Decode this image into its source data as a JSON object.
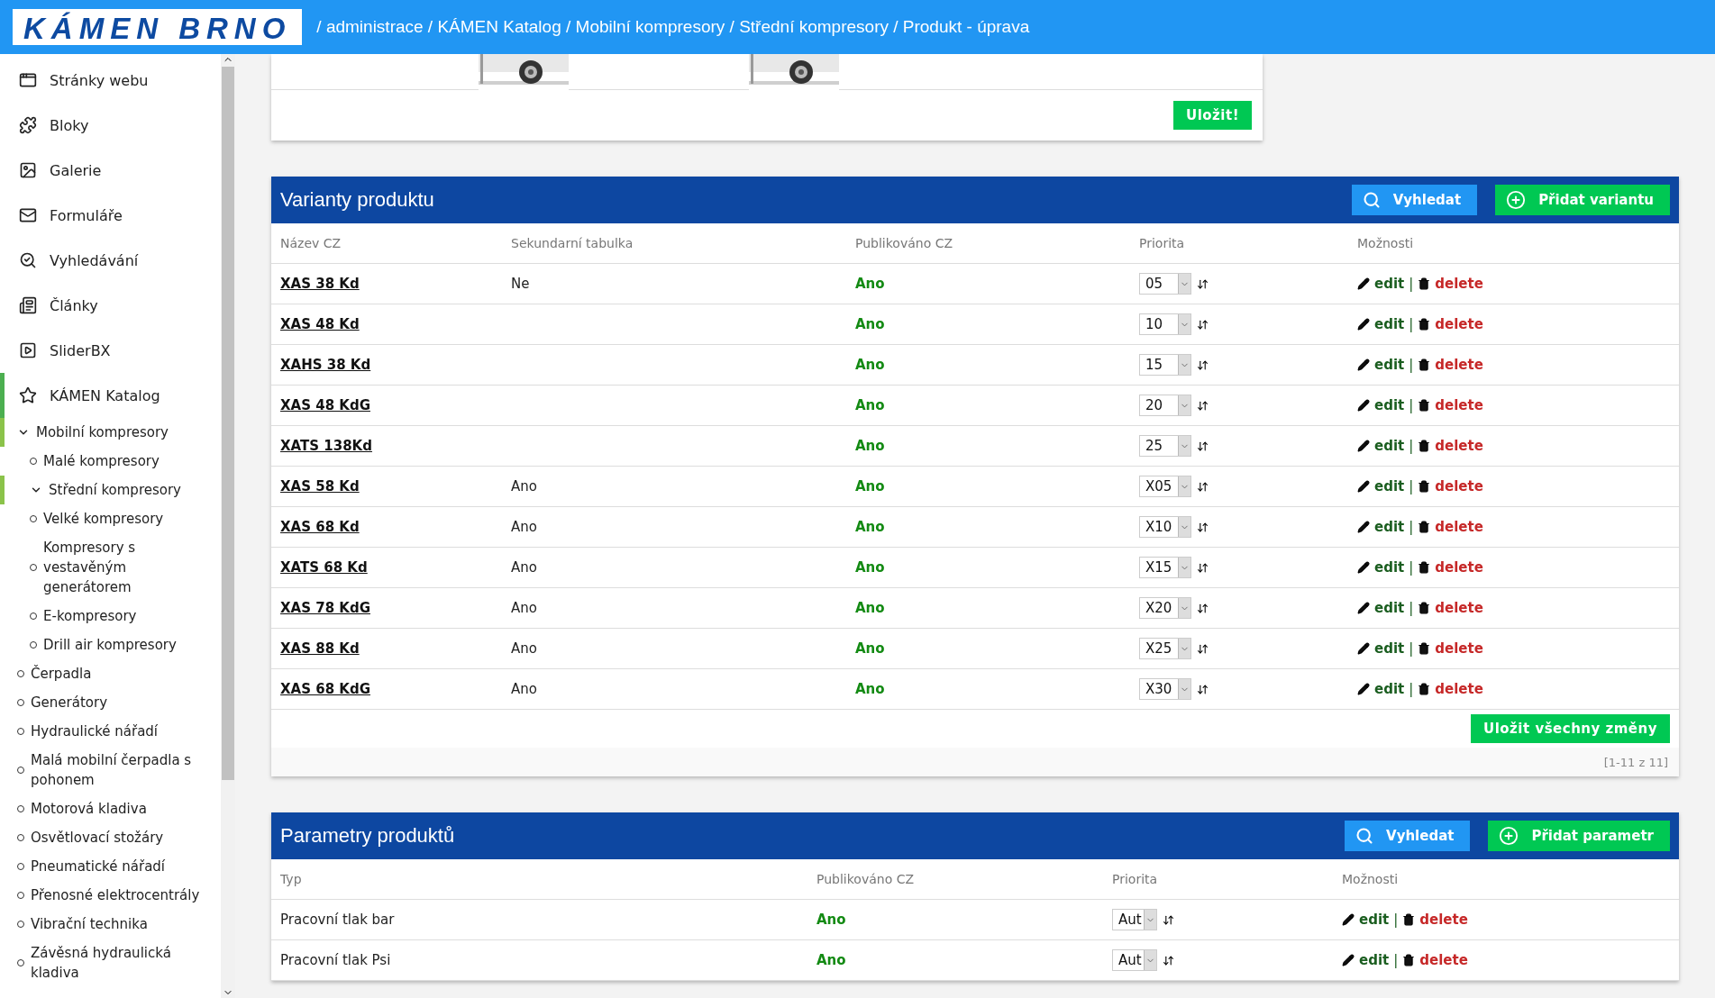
{
  "header": {
    "logo": "KÁMEN BRNO",
    "breadcrumb": "/ administrace / KÁMEN Katalog / Mobilní kompresory / Střední kompresory / Produkt - úprava"
  },
  "sidebar": {
    "items": [
      {
        "label": "Stránky webu",
        "selected": false
      },
      {
        "label": "Bloky",
        "selected": false
      },
      {
        "label": "Galerie",
        "selected": false
      },
      {
        "label": "Formuláře",
        "selected": false
      },
      {
        "label": "Vyhledávání",
        "selected": false
      },
      {
        "label": "Články",
        "selected": false
      },
      {
        "label": "SliderBX",
        "selected": false
      },
      {
        "label": "KÁMEN Katalog",
        "selected": true,
        "children": [
          {
            "label": "Mobilní kompresory",
            "selected": true,
            "expanded": true,
            "children": [
              {
                "label": "Malé kompresory",
                "selected": false,
                "expanded": false
              },
              {
                "label": "Střední kompresory",
                "selected": true,
                "expanded": true
              },
              {
                "label": "Velké kompresory",
                "selected": false,
                "expanded": false
              },
              {
                "label": "Kompresory s vestavěným generátorem",
                "selected": false,
                "expanded": false
              },
              {
                "label": "E-kompresory",
                "selected": false,
                "expanded": false
              },
              {
                "label": "Drill air kompresory",
                "selected": false,
                "expanded": false
              }
            ]
          },
          {
            "label": "Čerpadla",
            "selected": false,
            "expanded": false
          },
          {
            "label": "Generátory",
            "selected": false,
            "expanded": false
          },
          {
            "label": "Hydraulické nářadí",
            "selected": false,
            "expanded": false
          },
          {
            "label": "Malá mobilní čerpadla s pohonem",
            "selected": false,
            "expanded": false
          },
          {
            "label": "Motorová kladiva",
            "selected": false,
            "expanded": false
          },
          {
            "label": "Osvětlovací stožáry",
            "selected": false,
            "expanded": false
          },
          {
            "label": "Pneumatické nářadí",
            "selected": false,
            "expanded": false
          },
          {
            "label": "Přenosné elektrocentrály",
            "selected": false,
            "expanded": false
          },
          {
            "label": "Vibrační technika",
            "selected": false,
            "expanded": false
          },
          {
            "label": "Závěsná hydraulická kladiva",
            "selected": false,
            "expanded": false
          }
        ]
      }
    ]
  },
  "top_card": {
    "save_button": "Uložit!"
  },
  "variants": {
    "title": "Varianty produktu",
    "search_button": "Vyhledat",
    "add_button": "Přidat variantu",
    "columns": [
      "Název CZ",
      "Sekundarní tabulka",
      "Publikováno CZ",
      "Priorita",
      "Možnosti"
    ],
    "rows": [
      {
        "name": "XAS 38 Kd",
        "secondary": "Ne",
        "published": "Ano",
        "priority": "05",
        "edit": "edit",
        "separator": "|",
        "delete": "delete"
      },
      {
        "name": "XAS 48 Kd",
        "published": "Ano",
        "priority": "10",
        "edit": "edit",
        "separator": "|",
        "delete": "delete"
      },
      {
        "name": "XAHS 38 Kd",
        "published": "Ano",
        "priority": "15",
        "edit": "edit",
        "separator": "|",
        "delete": "delete"
      },
      {
        "name": "XAS 48 KdG",
        "published": "Ano",
        "priority": "20",
        "edit": "edit",
        "separator": "|",
        "delete": "delete"
      },
      {
        "name": "XATS 138Kd",
        "published": "Ano",
        "priority": "25",
        "edit": "edit",
        "separator": "|",
        "delete": "delete"
      },
      {
        "name": "XAS 58 Kd",
        "secondary": "Ano",
        "published": "Ano",
        "priority": "X05",
        "edit": "edit",
        "separator": "|",
        "delete": "delete"
      },
      {
        "name": "XAS 68 Kd",
        "secondary": "Ano",
        "published": "Ano",
        "priority": "X10",
        "edit": "edit",
        "separator": "|",
        "delete": "delete"
      },
      {
        "name": "XATS 68 Kd",
        "secondary": "Ano",
        "published": "Ano",
        "priority": "X15",
        "edit": "edit",
        "separator": "|",
        "delete": "delete"
      },
      {
        "name": "XAS 78 KdG",
        "secondary": "Ano",
        "published": "Ano",
        "priority": "X20",
        "edit": "edit",
        "separator": "|",
        "delete": "delete"
      },
      {
        "name": "XAS 88 Kd",
        "secondary": "Ano",
        "published": "Ano",
        "priority": "X25",
        "edit": "edit",
        "separator": "|",
        "delete": "delete"
      },
      {
        "name": "XAS 68 KdG",
        "secondary": "Ano",
        "published": "Ano",
        "priority": "X30",
        "edit": "edit",
        "separator": "|",
        "delete": "delete"
      }
    ],
    "save_all_button": "Uložit všechny změny",
    "pagination": "[1-11 z 11]"
  },
  "parameters": {
    "title": "Parametry produktů",
    "search_button": "Vyhledat",
    "add_button": "Přidat parametr",
    "columns": [
      "Typ",
      "Publikováno CZ",
      "Priorita",
      "Možnosti"
    ],
    "rows": [
      {
        "type": "Pracovní tlak bar",
        "published": "Ano",
        "priority": "Aut",
        "edit": "edit",
        "separator": "|",
        "delete": "delete"
      },
      {
        "type": "Pracovní tlak Psi",
        "published": "Ano",
        "priority": "Aut",
        "edit": "edit",
        "separator": "|",
        "delete": "delete"
      }
    ]
  }
}
